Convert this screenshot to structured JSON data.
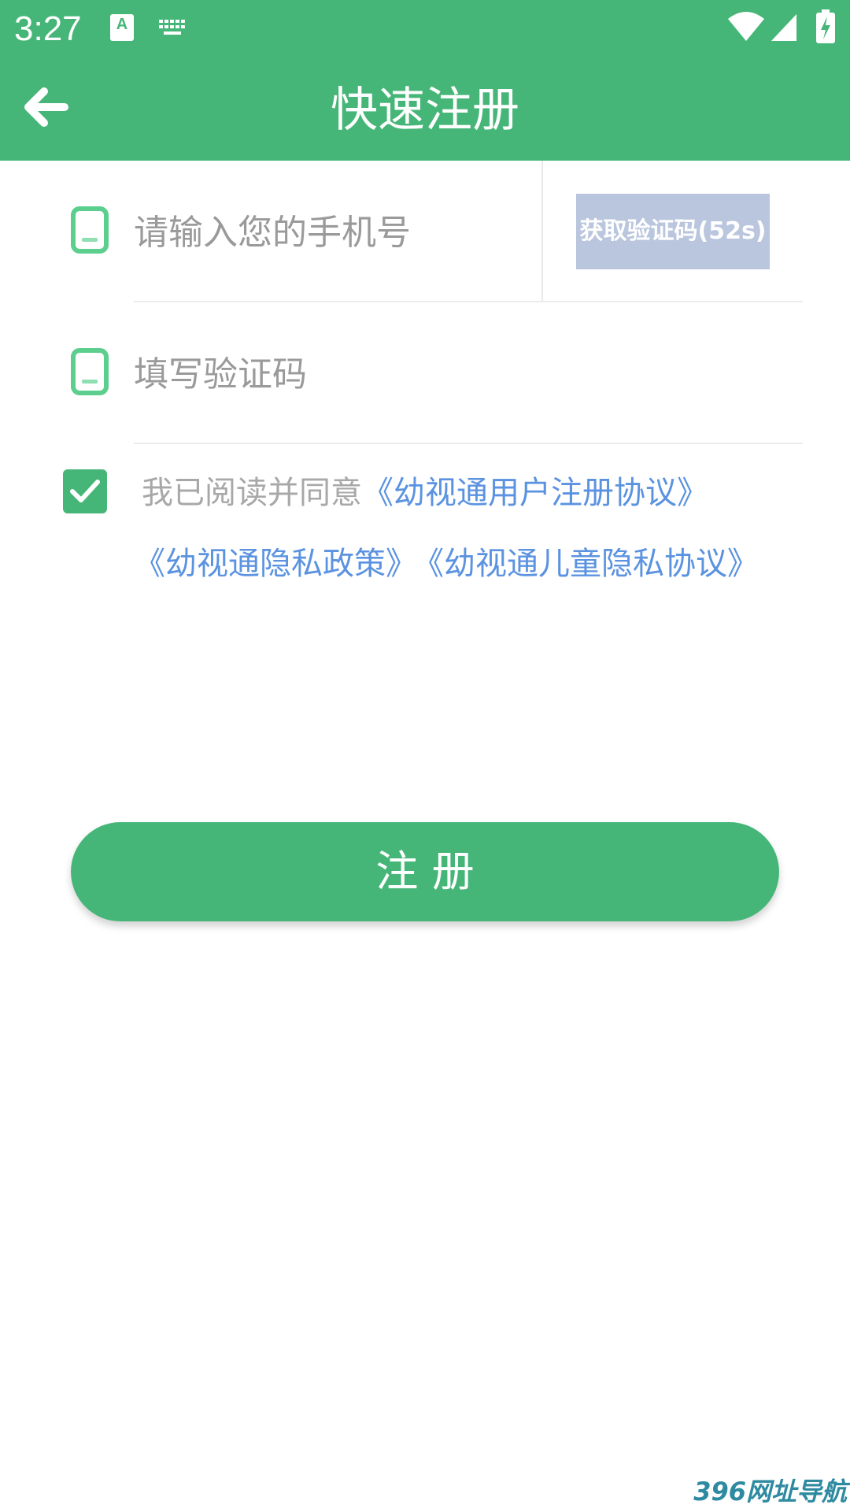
{
  "status_bar": {
    "time": "3:27",
    "input_method_letter": "A"
  },
  "header": {
    "title": "快速注册",
    "back_icon": "arrow-left-icon",
    "background": "#46b678"
  },
  "form": {
    "phone_placeholder": "请输入您的手机号",
    "phone_value": "",
    "get_code_label": "获取验证码(52s)",
    "code_placeholder": "填写验证码",
    "code_value": "",
    "field_icon": "phone-icon"
  },
  "agreement": {
    "checked": true,
    "prefix": "我已阅读并同意",
    "user_agreement": "《幼视通用户注册协议》",
    "privacy_policy": "《幼视通隐私政策》",
    "child_privacy": "《幼视通儿童隐私协议》"
  },
  "register_button_label": "注 册",
  "watermark": "396网址导航",
  "colors": {
    "accent": "#46b678",
    "link": "#5b93e0",
    "disabled_button": "#bac6dd"
  }
}
